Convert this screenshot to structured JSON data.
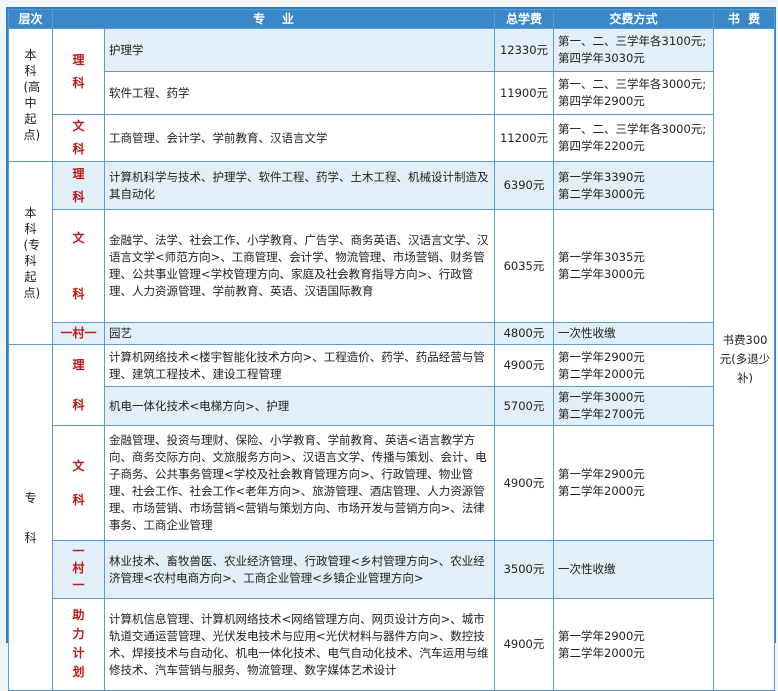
{
  "header": {
    "col1": "层次",
    "col2": "专    业",
    "col3": "总学费",
    "col4": "交费方式",
    "col5": "书  费"
  },
  "levels": {
    "benke_gaoqi": "本科(高中起点)",
    "benke_zhuanqi": "本科(专科起点)",
    "zhuanke": "专  科"
  },
  "categories": {
    "like": "理科",
    "wenke": "文科",
    "yicunyi": "一村一",
    "zhuli": "助力计划"
  },
  "rows": [
    {
      "major": "护理学",
      "fee": "12330元",
      "pay": "第一、二、三学年各3100元;第四学年3030元"
    },
    {
      "major": "软件工程、药学",
      "fee": "11900元",
      "pay": "第一、二、三学年各3000元;第四学年2900元"
    },
    {
      "major": "工商管理、会计学、学前教育、汉语言文学",
      "fee": "11200元",
      "pay": "第一、二、三学年各3000元;第四学年2200元"
    },
    {
      "major": "计算机科学与技术、护理学、软件工程、药学、土木工程、机械设计制造及其自动化",
      "fee": "6390元",
      "pay": "第一学年3390元\n第二学年3000元"
    },
    {
      "major": "金融学、法学、社会工作、小学教育、广告学、商务英语、汉语言文学、汉语言文学<师范方向>、工商管理、会计学、物流管理、市场营销、财务管理、公共事业管理<学校管理方向、家庭及社会教育指导方向>、行政管理、人力资源管理、学前教育、英语、汉语国际教育",
      "fee": "6035元",
      "pay": "第一学年3035元\n第二学年3000元"
    },
    {
      "major": "园艺",
      "fee": "4800元",
      "pay": "一次性收缴"
    },
    {
      "major": "计算机网络技术<楼宇智能化技术方向>、工程造价、药学、药品经营与管理、建筑工程技术、建设工程管理",
      "fee": "4900元",
      "pay": "第一学年2900元\n第二学年2000元"
    },
    {
      "major": "机电一体化技术<电梯方向>、护理",
      "fee": "5700元",
      "pay": "第一学年3000元\n第二学年2700元"
    },
    {
      "major": "金融管理、投资与理财、保险、小学教育、学前教育、英语<语言教学方向、商务交际方向、文旅服务方向>、汉语言文学、传播与策划、会计、电子商务、公共事务管理<学校及社会教育管理方向>、行政管理、物业管理、社会工作、社会工作<老年方向>、旅游管理、酒店管理、人力资源管理、市场营销、市场营销<营销与策划方向、市场开发与营销方向>、法律事务、工商企业管理",
      "fee": "4900元",
      "pay": "第一学年2900元\n第二学年2000元"
    },
    {
      "major": "林业技术、畜牧兽医、农业经济管理、行政管理<乡村管理方向>、农业经济管理<农村电商方向>、工商企业管理<乡镇企业管理方向>",
      "fee": "3500元",
      "pay": "一次性收缴"
    },
    {
      "major": "计算机信息管理、计算机网络技术<网络管理方向、网页设计方向>、城市轨道交通运营管理、光伏发电技术与应用<光伏材料与器件方向>、数控技术、焊接技术与自动化、机电一体化技术、电气自动化技术、汽车运用与维修技术、汽车营销与服务、物流管理、数字媒体艺术设计",
      "fee": "4900元",
      "pay": "第一学年2900元\n第二学年2000元"
    }
  ],
  "book_fee": "书费300元(多退少补)",
  "colors": {
    "header_bg": "#3b88c9",
    "border": "#5b9bd5",
    "category_red": "#c01818",
    "shade": "#e2eef8"
  }
}
